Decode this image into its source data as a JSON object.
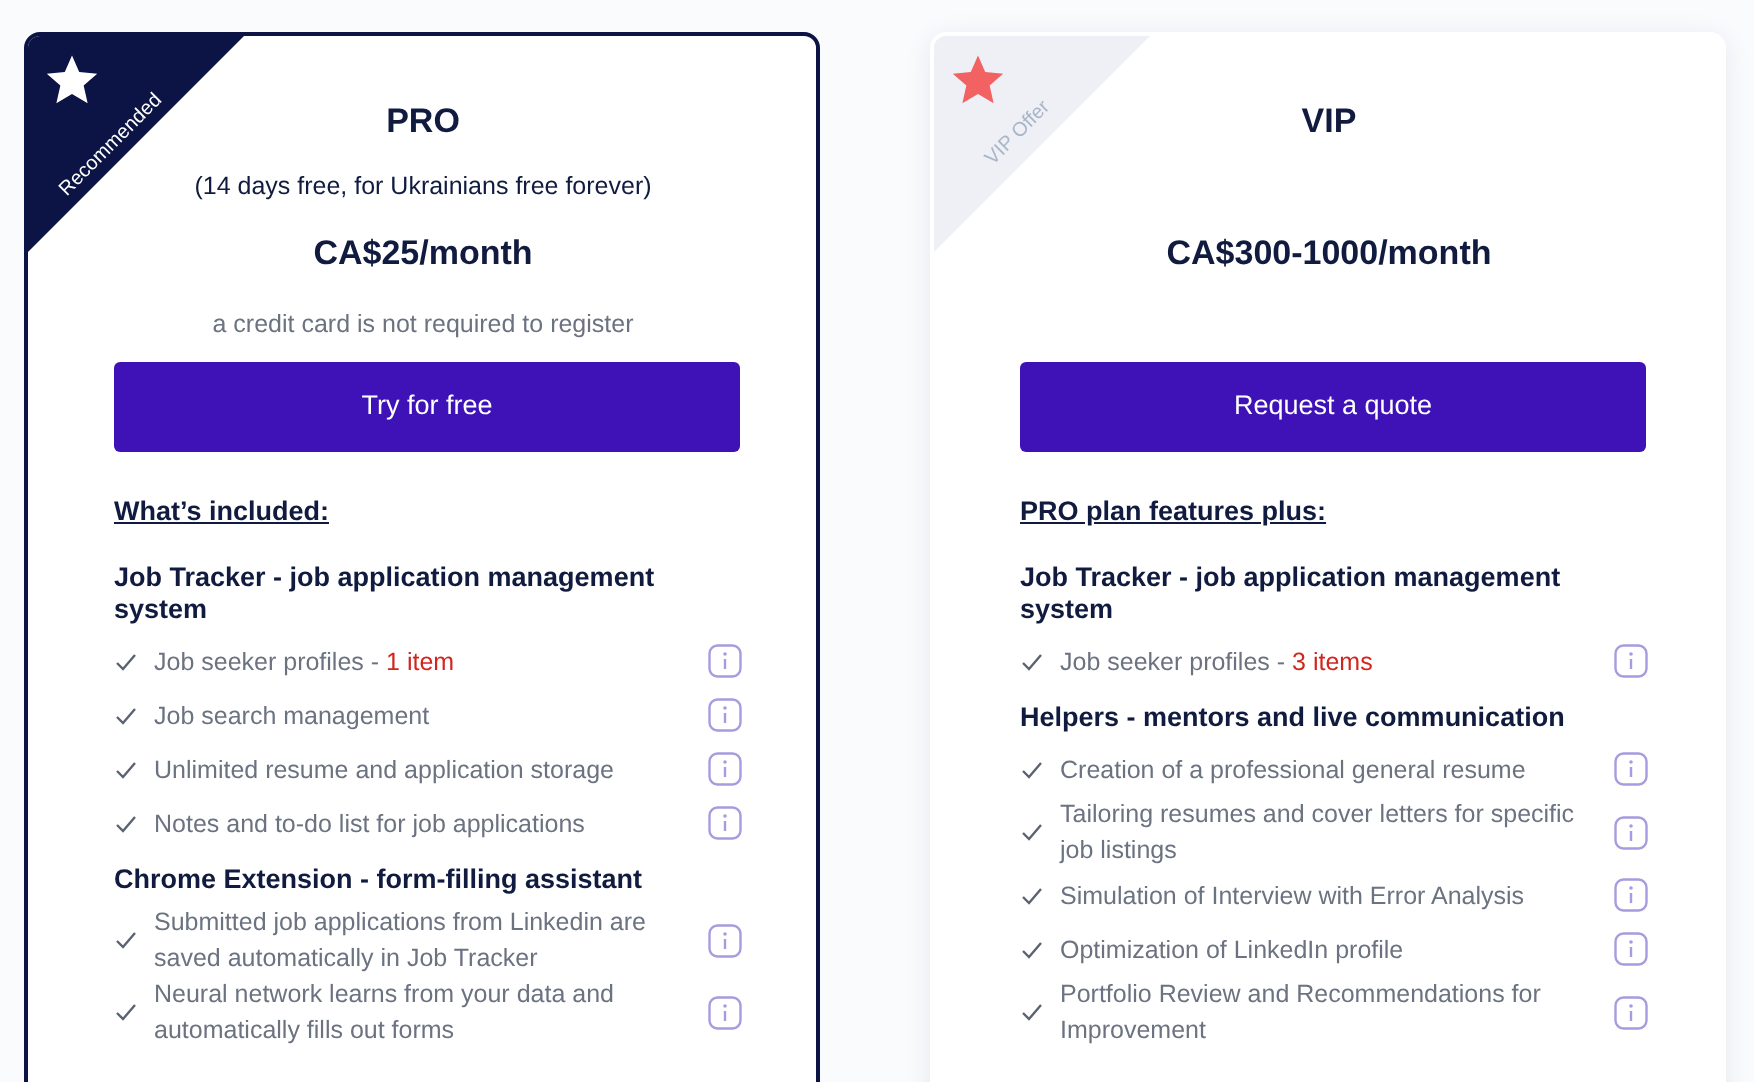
{
  "plans": [
    {
      "ribbon": {
        "kind": "recommended",
        "label": "Recommended"
      },
      "name": "PRO",
      "note": "(14 days free, for Ukrainians free forever)",
      "price": "CA$25/month",
      "subnote": "a credit card is not required to register",
      "button": "Try for free",
      "section_heading": "What’s included:",
      "highlighted": true,
      "groups": [
        {
          "title": "Job Tracker - job application management system",
          "features": [
            {
              "text": "Job seeker profiles - ",
              "highlight": "1 item"
            },
            {
              "text": "Job search management"
            },
            {
              "text": "Unlimited resume and application storage"
            },
            {
              "text": "Notes and to-do list for job applications"
            }
          ]
        },
        {
          "title": "Chrome Extension - form-filling assistant",
          "features": [
            {
              "text": "Submitted job applications from Linkedin are saved automatically in Job Tracker"
            },
            {
              "text": "Neural network learns from your data and automatically fills out forms"
            }
          ]
        }
      ]
    },
    {
      "ribbon": {
        "kind": "offer",
        "label": "VIP Offer"
      },
      "name": "VIP",
      "price": "CA$300-1000/month",
      "button": "Request a quote",
      "section_heading": "PRO plan features plus:",
      "highlighted": false,
      "groups": [
        {
          "title": "Job Tracker - job application management system",
          "features": [
            {
              "text": "Job seeker profiles - ",
              "highlight": "3 items"
            }
          ]
        },
        {
          "title": "Helpers - mentors and live communication",
          "features": [
            {
              "text": "Creation of a professional general resume"
            },
            {
              "text": "Tailoring resumes and cover letters for specific job listings"
            },
            {
              "text": "Simulation of Interview with Error Analysis"
            },
            {
              "text": "Optimization of LinkedIn profile"
            },
            {
              "text": "Portfolio Review and Recommendations for Improvement"
            }
          ]
        }
      ]
    }
  ]
}
